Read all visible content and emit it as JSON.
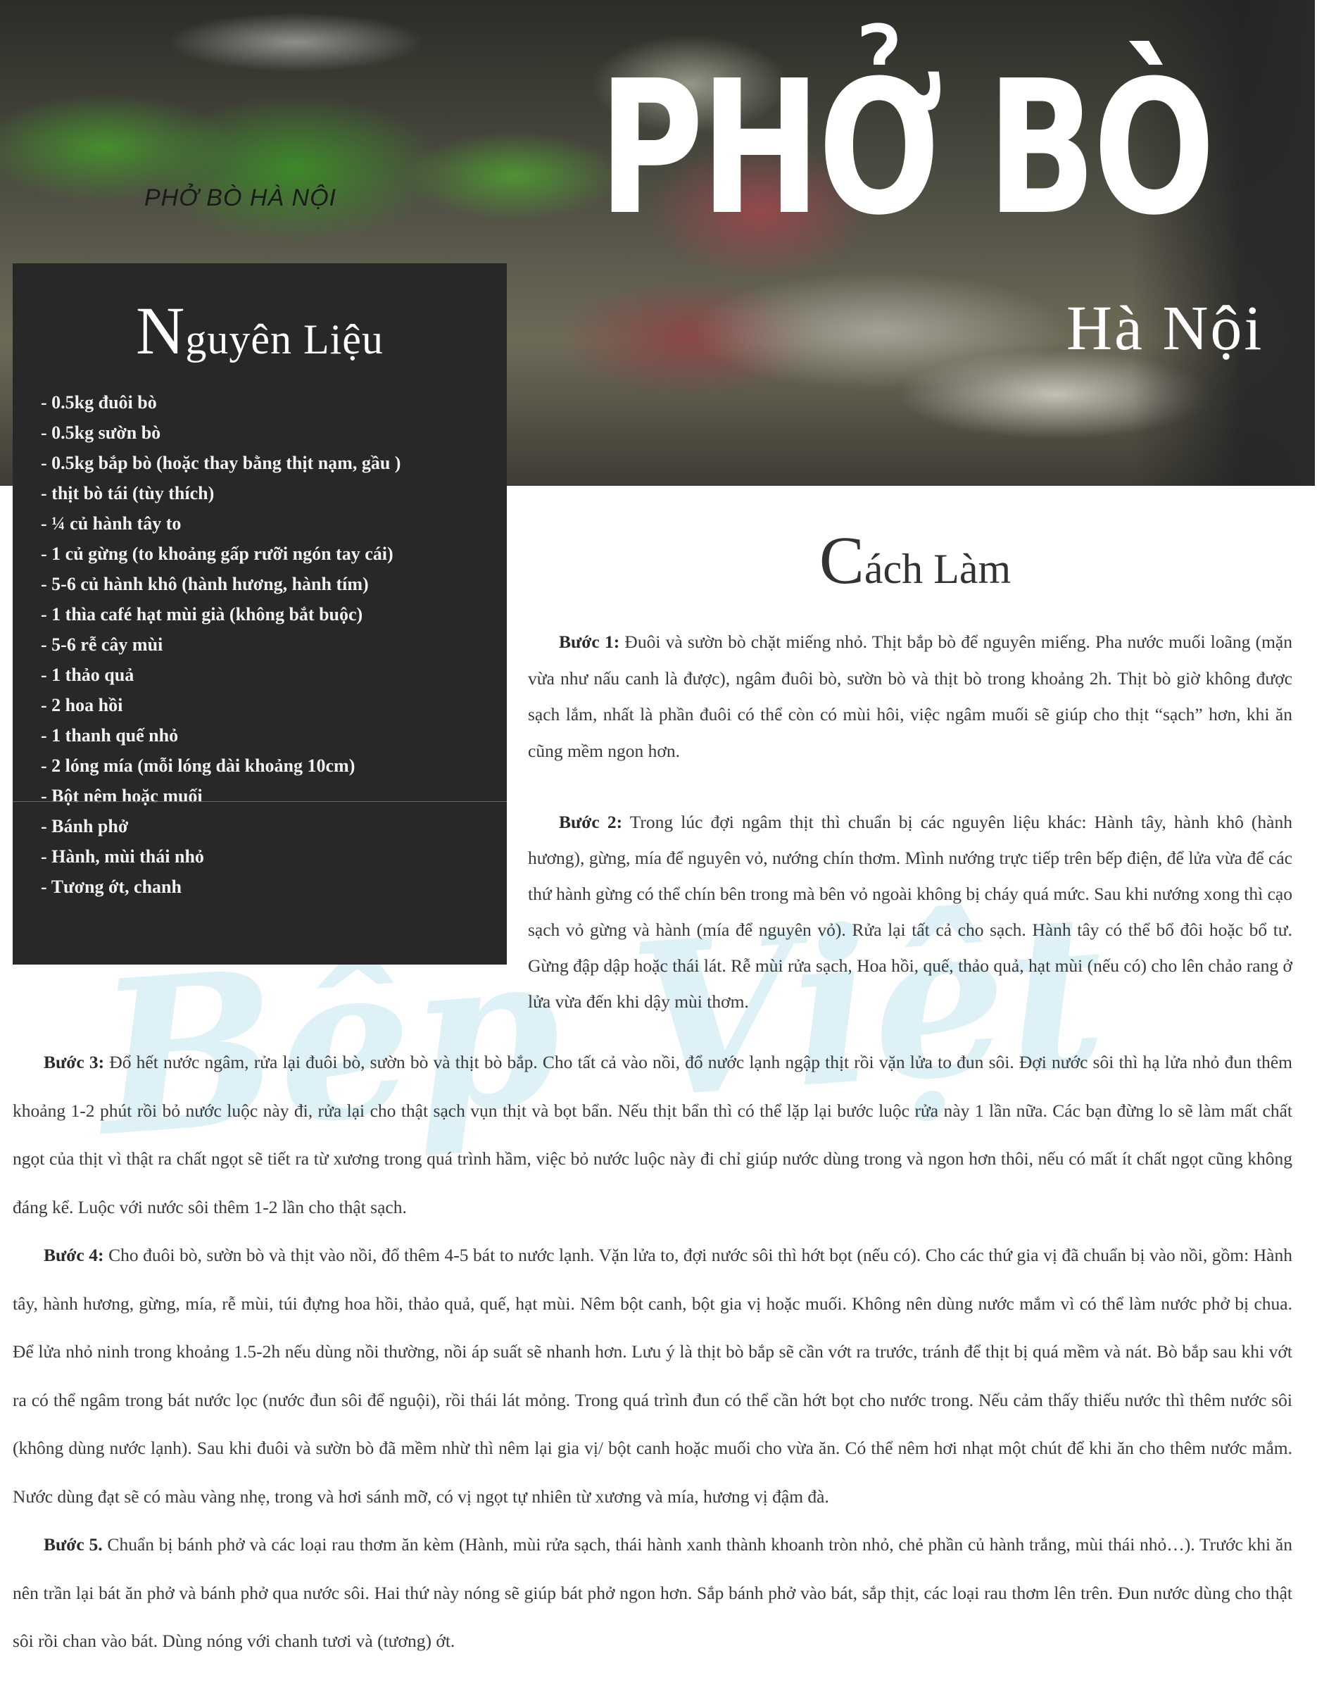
{
  "hero": {
    "small_caption": "PHỞ BÒ  HÀ NỘI",
    "title": "PHỞ BÒ",
    "subtitle": "Hà Nội"
  },
  "ingredients": {
    "title_cap": "N",
    "title_rest": "guyên Liệu",
    "items": [
      "- 0.5kg đuôi bò",
      "- 0.5kg sườn bò",
      "- 0.5kg bắp bò (hoặc thay bằng thịt nạm, gầu )",
      "- thịt bò tái (tùy thích)",
      "- ¼ củ hành tây to",
      "- 1 củ gừng (to khoảng gấp rưỡi ngón tay cái)",
      "- 5-6 củ hành khô (hành hương, hành tím)",
      "- 1 thìa café hạt mùi già (không bắt buộc)",
      "- 5-6 rễ cây mùi",
      "- 1 thảo quả",
      "- 2 hoa hồi",
      "- 1 thanh quế nhỏ",
      "- 2 lóng mía (mỗi lóng dài khoảng 10cm)",
      "- Bột nêm hoặc muối",
      "- Bánh phở",
      "- Hành, mùi thái nhỏ",
      "- Tương ớt, chanh"
    ]
  },
  "watermark": {
    "text": "Bếp Việt"
  },
  "method": {
    "title_cap": "C",
    "title_rest": "ách Làm",
    "steps": [
      {
        "label": "Bước 1:",
        "text": " Đuôi và sườn bò chặt miếng nhỏ. Thịt bắp bò để nguyên miếng. Pha nước muối loãng (mặn vừa như nấu canh là được), ngâm đuôi bò, sườn bò và thịt bò trong khoảng 2h. Thịt bò giờ không được sạch lắm, nhất là phần đuôi có thể còn có mùi hôi, việc ngâm muối sẽ giúp cho thịt “sạch” hơn, khi ăn cũng mềm ngon hơn."
      },
      {
        "label": "Bước 2:",
        "text": " Trong lúc đợi ngâm thịt thì chuẩn bị các nguyên liệu khác: Hành tây, hành khô (hành hương), gừng, mía để nguyên vỏ, nướng chín thơm. Mình nướng trực tiếp trên bếp điện, để lửa vừa để các thứ hành gừng có thể chín bên trong mà bên vỏ ngoài không bị cháy quá mức. Sau khi nướng xong thì cạo sạch vỏ gừng và hành (mía để nguyên vỏ). Rửa lại tất cả cho sạch. Hành tây có thể bổ đôi hoặc bổ tư. Gừng đập dập hoặc thái lát. Rễ mùi rửa sạch, Hoa hồi, quế, thảo quả, hạt mùi (nếu có) cho lên chảo rang ở lửa vừa đến khi dậy mùi thơm."
      },
      {
        "label": "Bước 3:",
        "text": " Đổ hết nước ngâm, rửa lại đuôi bò, sườn bò và thịt bò bắp. Cho tất cả vào nồi, đổ nước lạnh ngập thịt rồi vặn lửa to đun sôi. Đợi nước sôi thì hạ lửa nhỏ đun thêm khoảng 1-2 phút rồi bỏ nước luộc này đi, rửa lại cho thật sạch vụn thịt và bọt bẩn. Nếu thịt bẩn thì có thể lặp lại bước luộc rửa này 1 lần nữa. Các bạn đừng lo sẽ làm mất chất ngọt của thịt vì thật ra chất ngọt sẽ tiết ra từ xương trong quá trình hầm, việc bỏ nước luộc này đi chỉ giúp nước dùng trong và ngon hơn thôi, nếu có mất ít chất ngọt cũng không đáng kể. Luộc với nước sôi thêm 1-2 lần cho thật sạch."
      },
      {
        "label": "Bước 4:",
        "text": "  Cho đuôi bò, sườn bò và thịt vào nồi, đổ thêm 4-5 bát to nước lạnh. Vặn lửa to, đợi nước sôi thì hớt bọt (nếu có). Cho các thứ gia vị đã chuẩn bị vào nồi, gồm: Hành tây, hành hương, gừng, mía, rễ mùi, túi đựng hoa hồi, thảo quả, quế, hạt mùi. Nêm bột canh, bột gia vị hoặc muối. Không nên dùng nước mắm vì có thể làm nước phở bị chua. Để lửa nhỏ ninh trong khoảng 1.5-2h nếu dùng nồi thường, nồi áp suất sẽ nhanh hơn. Lưu ý là thịt bò bắp sẽ cần vớt ra trước, tránh để thịt bị quá mềm và nát. Bò bắp sau khi vớt ra có thể ngâm trong bát nước lọc (nước đun sôi để nguội), rồi thái lát mỏng. Trong quá trình đun có thể cần hớt bọt cho nước trong. Nếu cảm thấy thiếu nước thì thêm nước sôi (không dùng nước lạnh). Sau khi đuôi và sườn bò đã mềm nhừ thì nêm lại gia vị/ bột canh hoặc muối cho vừa ăn. Có thể nêm hơi nhạt một chút để khi ăn cho thêm nước mắm. Nước dùng đạt sẽ có màu vàng nhẹ, trong và hơi sánh mỡ, có vị ngọt tự nhiên từ xương và mía, hương vị đậm đà."
      },
      {
        "label": "Bước 5.",
        "text": " Chuẩn bị bánh phở và các loại rau thơm ăn kèm (Hành, mùi rửa sạch, thái hành xanh thành khoanh tròn nhỏ, chẻ phần củ hành trắng, mùi thái nhỏ…). Trước khi ăn nên trần lại bát ăn phở và bánh phở qua nước sôi. Hai thứ này nóng sẽ giúp bát phở ngon hơn. Sắp bánh phở vào bát, sắp thịt, các loại rau thơm lên trên. Đun nước dùng cho thật sôi rồi chan vào bát. Dùng nóng với chanh tươi và (tương) ớt."
      }
    ]
  }
}
